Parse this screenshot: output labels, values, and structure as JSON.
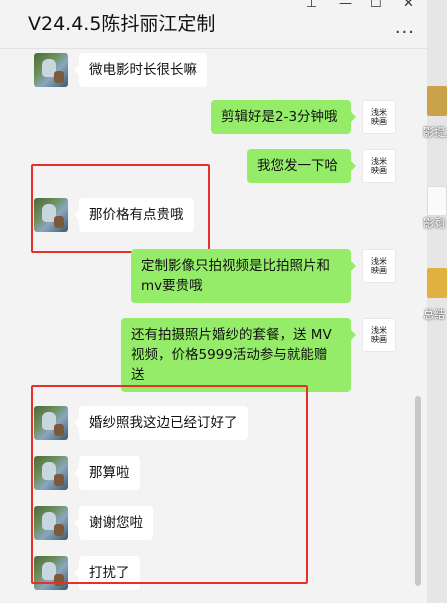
{
  "window": {
    "title": "V24.4.5陈抖丽江定制",
    "pin_icon": "⊥",
    "minimize_icon": "—",
    "maximize_icon": "☐",
    "close_icon": "✕",
    "more_icon": "···"
  },
  "brand_avatar": {
    "line1": "浅米",
    "line2": "映画"
  },
  "messages": [
    {
      "from": "other",
      "text": "微电影时长很长嘛"
    },
    {
      "from": "me",
      "text": "剪辑好是2-3分钟哦"
    },
    {
      "from": "me",
      "text": "我您发一下哈"
    },
    {
      "from": "other",
      "text": "那价格有点贵哦"
    },
    {
      "from": "me",
      "line1": " 定制影像只拍视频是比拍照片和",
      "line2": "mv要贵哦"
    },
    {
      "from": "me",
      "line1": "还有拍摄照片婚纱的套餐，送 MV",
      "line2": "视频，价格5999活动参与就能赠",
      "line3": "送"
    },
    {
      "from": "other",
      "text": "婚纱照我这边已经订好了"
    },
    {
      "from": "other",
      "text": "那算啦"
    },
    {
      "from": "other",
      "text": "谢谢您啦"
    },
    {
      "from": "other",
      "text": "打扰了"
    }
  ],
  "desktop": {
    "label1": "影提方",
    "label2": "影剩",
    "label3": "总结"
  }
}
